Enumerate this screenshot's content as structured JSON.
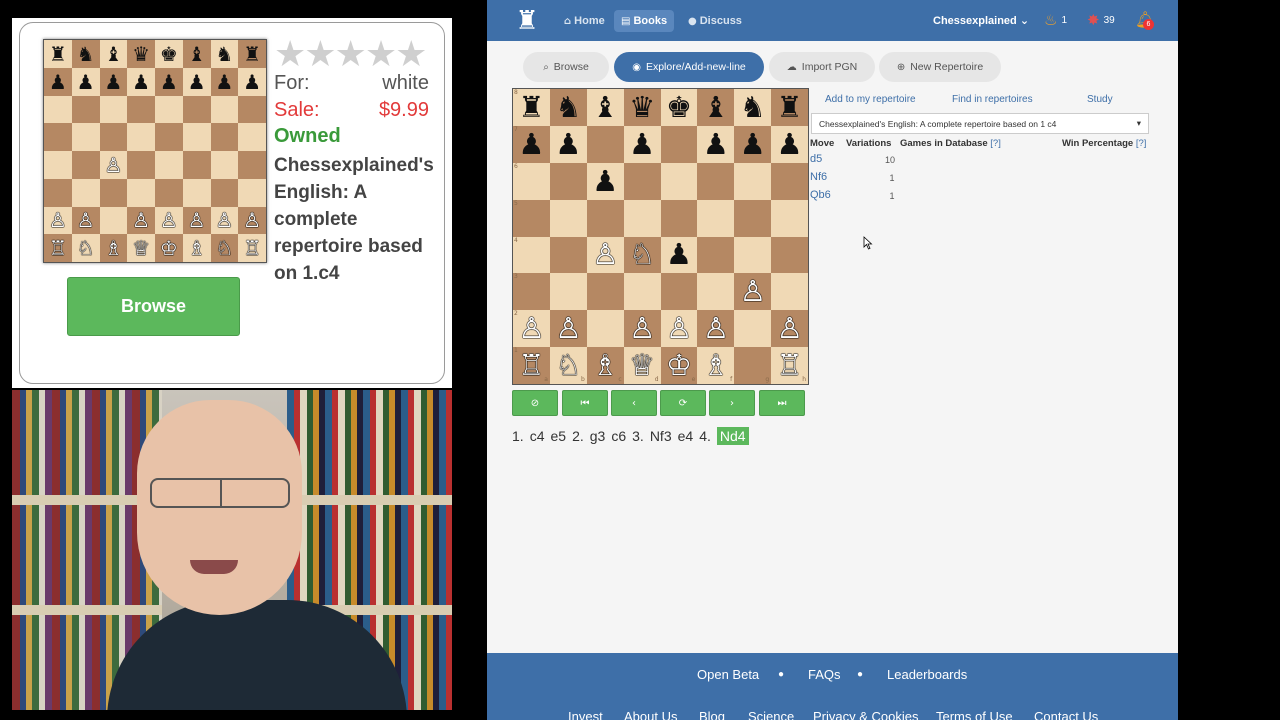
{
  "overlay": {
    "stars": "★★★★★",
    "for_label": "For:",
    "for_value": "white",
    "sale_label": "Sale:",
    "sale_value": "$9.99",
    "owned": "Owned",
    "title": "Chessexplained's English: A complete repertoire based on 1.c4",
    "browse_button": "Browse",
    "mini_board": [
      [
        "♜",
        "♞",
        "♝",
        "♛",
        "♚",
        "♝",
        "♞",
        "♜"
      ],
      [
        "♟",
        "♟",
        "♟",
        "♟",
        "♟",
        "♟",
        "♟",
        "♟"
      ],
      [
        "",
        "",
        "",
        "",
        "",
        "",
        "",
        ""
      ],
      [
        "",
        "",
        "",
        "",
        "",
        "",
        "",
        ""
      ],
      [
        "",
        "",
        "♙",
        "",
        "",
        "",
        "",
        ""
      ],
      [
        "",
        "",
        "",
        "",
        "",
        "",
        "",
        ""
      ],
      [
        "♙",
        "♙",
        "",
        "♙",
        "♙",
        "♙",
        "♙",
        "♙"
      ],
      [
        "♖",
        "♘",
        "♗",
        "♕",
        "♔",
        "♗",
        "♘",
        "♖"
      ]
    ]
  },
  "navbar": {
    "home": "Home",
    "books": "Books",
    "discuss": "Discuss",
    "user": "Chessexplained",
    "stat1": "1",
    "stat2": "39",
    "bell_count": "6"
  },
  "tabs": {
    "browse": "Browse",
    "explore": "Explore/Add-new-line",
    "import": "Import PGN",
    "new": "New Repertoire"
  },
  "board": {
    "ranks": [
      "8",
      "7",
      "6",
      "5",
      "4",
      "3",
      "2",
      "1"
    ],
    "files": [
      "a",
      "b",
      "c",
      "d",
      "e",
      "f",
      "g",
      "h"
    ],
    "position": [
      [
        "♜",
        "♞",
        "♝",
        "♛",
        "♚",
        "♝",
        "♞",
        "♜"
      ],
      [
        "♟",
        "♟",
        "",
        "♟",
        "",
        "♟",
        "♟",
        "♟"
      ],
      [
        "",
        "",
        "♟",
        "",
        "",
        "",
        "",
        ""
      ],
      [
        "",
        "",
        "",
        "",
        "",
        "",
        "",
        ""
      ],
      [
        "",
        "",
        "♙",
        "♘",
        "♟",
        "",
        "",
        ""
      ],
      [
        "",
        "",
        "",
        "",
        "",
        "",
        "♙",
        ""
      ],
      [
        "♙",
        "♙",
        "",
        "♙",
        "♙",
        "♙",
        "",
        "♙"
      ],
      [
        "♖",
        "♘",
        "♗",
        "♕",
        "♔",
        "♗",
        "",
        "♖"
      ]
    ]
  },
  "controls": [
    "⊘",
    "⏮",
    "‹",
    "⟳",
    "›",
    "⏭"
  ],
  "moves": {
    "m1": "1.",
    "w1": "c4",
    "b1": "e5",
    "m2": "2.",
    "w2": "g3",
    "b2": "c6",
    "m3": "3.",
    "w3": "Nf3",
    "b3": "e4",
    "m4": "4.",
    "w4": "Nd4"
  },
  "side": {
    "add_link": "Add to my repertoire",
    "find_link": "Find in repertoires",
    "study_link": "Study",
    "repertoire_select": "Chessexplained's English: A complete repertoire based on 1 c4",
    "headers": {
      "move": "Move",
      "variations": "Variations",
      "games": "Games in Database",
      "games_q": "[?]",
      "win": "Win Percentage",
      "win_q": "[?]"
    },
    "rows": [
      {
        "move": "d5",
        "variations": "10"
      },
      {
        "move": "Nf6",
        "variations": "1"
      },
      {
        "move": "Qb6",
        "variations": "1"
      }
    ]
  },
  "footer": {
    "open_beta": "Open Beta",
    "faqs": "FAQs",
    "leaderboards": "Leaderboards",
    "bottom": [
      "Invest",
      "About Us",
      "Blog",
      "Science",
      "Privacy & Cookies",
      "Terms of Use",
      "Contact Us"
    ]
  }
}
